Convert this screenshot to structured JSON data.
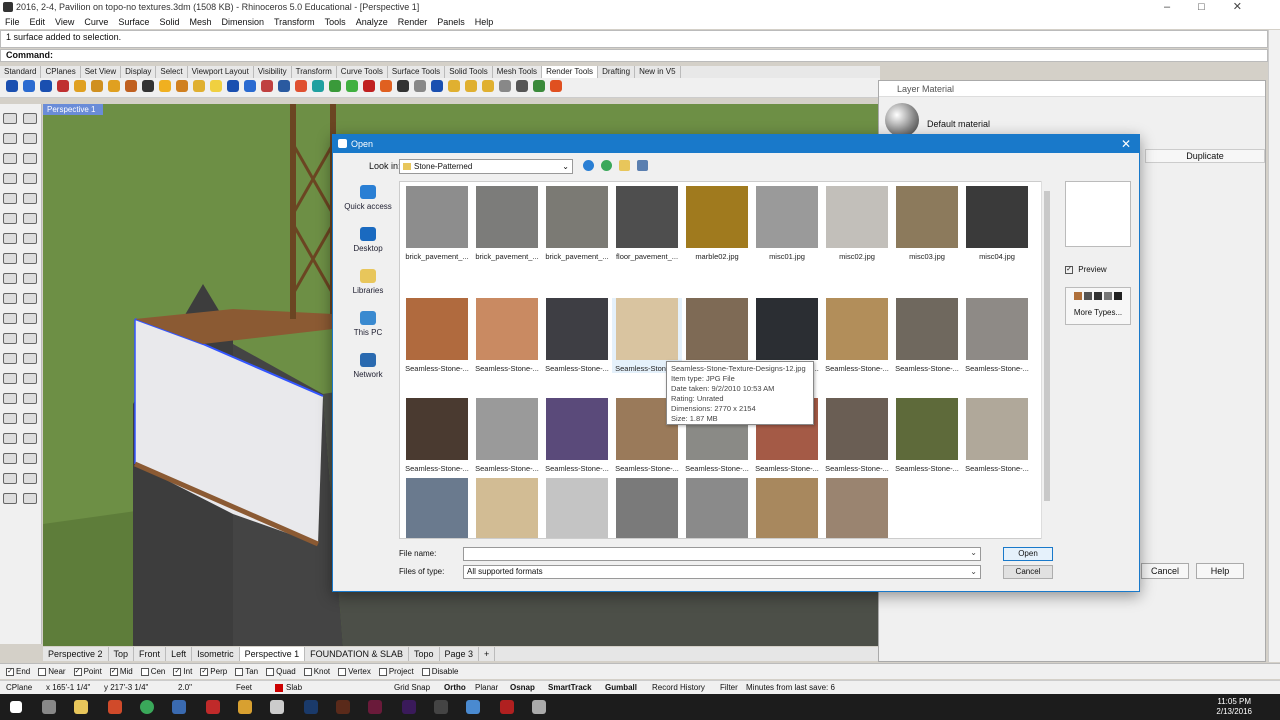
{
  "window": {
    "title": "2016, 2-4, Pavilion on topo-no textures.3dm (1508 KB) - Rhinoceros 5.0 Educational - [Perspective 1]"
  },
  "menu": [
    "File",
    "Edit",
    "View",
    "Curve",
    "Surface",
    "Solid",
    "Mesh",
    "Dimension",
    "Transform",
    "Tools",
    "Analyze",
    "Render",
    "Panels",
    "Help"
  ],
  "command": {
    "history": "1 surface added to selection.",
    "prompt": "Command:"
  },
  "toolbar_tabs": [
    "Standard",
    "CPlanes",
    "Set View",
    "Display",
    "Select",
    "Viewport Layout",
    "Visibility",
    "Transform",
    "Curve Tools",
    "Surface Tools",
    "Solid Tools",
    "Mesh Tools",
    "Render Tools",
    "Drafting",
    "New in V5"
  ],
  "toolbar_active": "Render Tools",
  "viewport": {
    "title": "Perspective 1"
  },
  "viewport_tabs": [
    "Perspective 2",
    "Top",
    "Front",
    "Left",
    "Isometric",
    "Perspective 1",
    "FOUNDATION & SLAB",
    "Topo",
    "Page 3",
    "+"
  ],
  "viewport_tab_active": "Perspective 1",
  "layer_panel": {
    "title": "Layer Material",
    "material": "Default material",
    "duplicate": "Duplicate",
    "cancel": "Cancel",
    "help": "Help"
  },
  "dialog": {
    "title": "Open",
    "look_in_label": "Look in:",
    "look_in_value": "Stone-Patterned",
    "places": [
      "Quick access",
      "Desktop",
      "Libraries",
      "This PC",
      "Network"
    ],
    "files": [
      {
        "name": "brick_pavement_...",
        "color": "#8d8d8d"
      },
      {
        "name": "brick_pavement_...",
        "color": "#7c7c7a"
      },
      {
        "name": "brick_pavement_...",
        "color": "#7b7a74"
      },
      {
        "name": "floor_pavement_...",
        "color": "#4e4e4e"
      },
      {
        "name": "marble02.jpg",
        "color": "#a07a1e"
      },
      {
        "name": "misc01.jpg",
        "color": "#9a9a9a"
      },
      {
        "name": "misc02.jpg",
        "color": "#c2bfba"
      },
      {
        "name": "misc03.jpg",
        "color": "#8c7a5c"
      },
      {
        "name": "misc04.jpg",
        "color": "#3a3a3a"
      },
      {
        "name": "Seamless-Stone-...",
        "color": "#b06a3e"
      },
      {
        "name": "Seamless-Stone-...",
        "color": "#c98a62"
      },
      {
        "name": "Seamless-Stone-...",
        "color": "#3e3e44"
      },
      {
        "name": "Seamless-Stone-...",
        "color": "#d9c4a0"
      },
      {
        "name": "Seamless-Stone-...",
        "color": "#7e6a55"
      },
      {
        "name": "Seamless-Stone-...",
        "color": "#2b2e33"
      },
      {
        "name": "Seamless-Stone-...",
        "color": "#b28e5a"
      },
      {
        "name": "Seamless-Stone-...",
        "color": "#6f685e"
      },
      {
        "name": "Seamless-Stone-...",
        "color": "#8e8a86"
      },
      {
        "name": "Seamless-Stone-...",
        "color": "#4a3a30"
      },
      {
        "name": "Seamless-Stone-...",
        "color": "#9a9a9a"
      },
      {
        "name": "Seamless-Stone-...",
        "color": "#5a4a7a"
      },
      {
        "name": "Seamless-Stone-...",
        "color": "#9a7a5a"
      },
      {
        "name": "Seamless-Stone-...",
        "color": "#8a8a86"
      },
      {
        "name": "Seamless-Stone-...",
        "color": "#a45a46"
      },
      {
        "name": "Seamless-Stone-...",
        "color": "#6a5e54"
      },
      {
        "name": "Seamless-Stone-...",
        "color": "#5e6a3a"
      },
      {
        "name": "Seamless-Stone-...",
        "color": "#b0a89a"
      },
      {
        "name": "",
        "color": "#6a7a8e"
      },
      {
        "name": "",
        "color": "#d2bc94"
      },
      {
        "name": "",
        "color": "#c4c4c4"
      },
      {
        "name": "",
        "color": "#7a7a7a"
      },
      {
        "name": "",
        "color": "#8a8a8a"
      },
      {
        "name": "",
        "color": "#a8885e"
      },
      {
        "name": "",
        "color": "#9a8470"
      }
    ],
    "tooltip": {
      "name": "Seamless-Stone-Texture-Designs-12.jpg",
      "type": "Item type: JPG File",
      "date": "Date taken: 9/2/2010 10:53 AM",
      "rating": "Rating: Unrated",
      "dimensions": "Dimensions: 2770 x 2154",
      "size": "Size: 1.87 MB"
    },
    "preview_label": "Preview",
    "more_types": "More Types...",
    "file_name_label": "File name:",
    "file_name_value": "",
    "files_of_type_label": "Files of type:",
    "files_of_type_value": "All supported formats",
    "open_label": "Open",
    "cancel_label": "Cancel"
  },
  "osnap": [
    {
      "label": "End",
      "on": true
    },
    {
      "label": "Near",
      "on": false
    },
    {
      "label": "Point",
      "on": true
    },
    {
      "label": "Mid",
      "on": true
    },
    {
      "label": "Cen",
      "on": false
    },
    {
      "label": "Int",
      "on": true
    },
    {
      "label": "Perp",
      "on": true
    },
    {
      "label": "Tan",
      "on": false
    },
    {
      "label": "Quad",
      "on": false
    },
    {
      "label": "Knot",
      "on": false
    },
    {
      "label": "Vertex",
      "on": false
    },
    {
      "label": "Project",
      "on": false
    },
    {
      "label": "Disable",
      "on": false
    }
  ],
  "status": {
    "cplane": "CPlane",
    "x": "x 165'-1 1/4\"",
    "y": "y 217'-3 1/4\"",
    "z": "2.0\"",
    "units": "Feet",
    "layer": "Slab",
    "layer_color": "#cc0000",
    "grid_snap": "Grid Snap",
    "ortho": "Ortho",
    "planar": "Planar",
    "osnap": "Osnap",
    "smarttrack": "SmartTrack",
    "gumball": "Gumball",
    "record_history": "Record History",
    "filter": "Filter",
    "minutes": "Minutes from last save: 6"
  },
  "clock": {
    "time": "11:05 PM",
    "date": "2/13/2016"
  }
}
